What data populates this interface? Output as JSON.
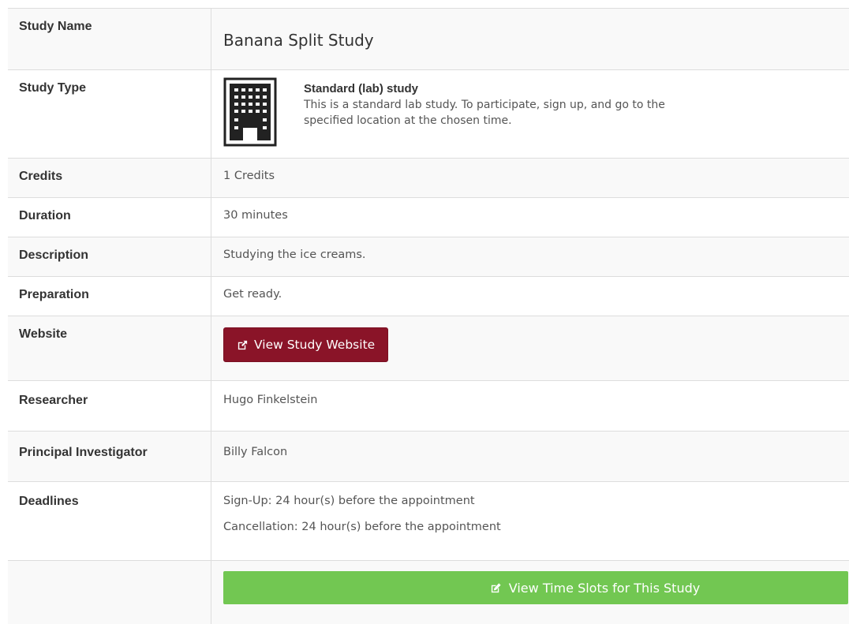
{
  "study": {
    "name_label": "Study Name",
    "name_value": "Banana Split Study",
    "type_label": "Study Type",
    "type_title": "Standard (lab) study",
    "type_desc_line1": "This is a standard lab study. To participate, sign up, and go to the",
    "type_desc_line2": "specified location at the chosen time.",
    "credits_label": "Credits",
    "credits_value": "1 Credits",
    "duration_label": "Duration",
    "duration_value": "30 minutes",
    "description_label": "Description",
    "description_value": "Studying the ice creams.",
    "preparation_label": "Preparation",
    "preparation_value": "Get ready.",
    "website_label": "Website",
    "website_button": "View Study Website",
    "researcher_label": "Researcher",
    "researcher_value": "Hugo Finkelstein",
    "pi_label": "Principal Investigator",
    "pi_value": "Billy Falcon",
    "deadlines_label": "Deadlines",
    "deadline_signup": "Sign-Up:  24 hour(s) before the appointment",
    "deadline_cancel": "Cancellation:  24 hour(s) before the appointment",
    "timeslots_button": "View Time Slots for This Study"
  },
  "icons": {
    "study_type": "building-icon",
    "website": "external-link-icon",
    "timeslots": "edit-icon"
  },
  "colors": {
    "website_button": "#8a1428",
    "timeslots_button": "#72c752"
  }
}
